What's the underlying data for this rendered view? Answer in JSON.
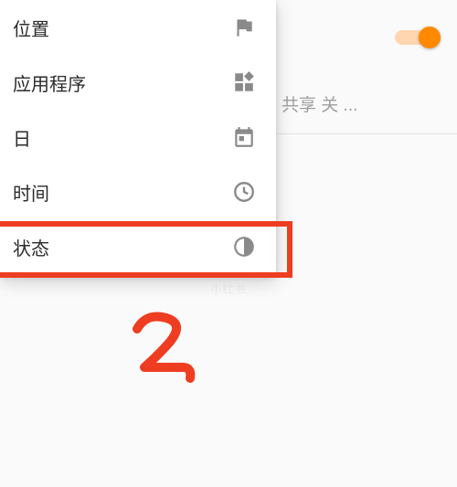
{
  "menu": {
    "items": [
      {
        "label": "位置",
        "icon": "flag-icon"
      },
      {
        "label": "应用程序",
        "icon": "apps-icon"
      },
      {
        "label": "日",
        "icon": "calendar-icon"
      },
      {
        "label": "时间",
        "icon": "clock-icon"
      },
      {
        "label": "状态",
        "icon": "half-circle-icon"
      }
    ]
  },
  "background": {
    "share_text": "共享 关 ...",
    "toggle_on": true
  },
  "annotation": {
    "highlight_index": 4,
    "handwritten": "2"
  },
  "watermark": "小红书"
}
